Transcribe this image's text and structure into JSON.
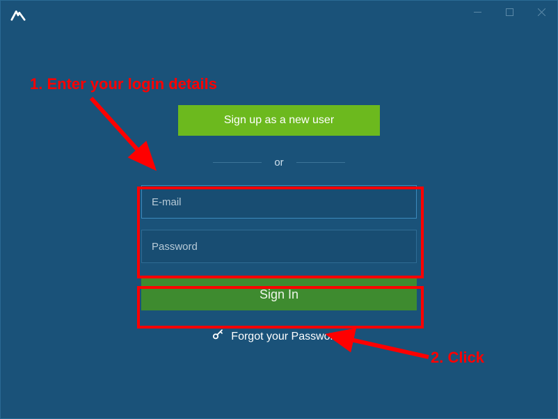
{
  "titlebar": {
    "app_logo": "nord-logo"
  },
  "signup": {
    "label": "Sign up as a new user"
  },
  "divider": {
    "label": "or"
  },
  "email": {
    "placeholder": "E-mail",
    "value": ""
  },
  "password": {
    "placeholder": "Password",
    "value": ""
  },
  "signin": {
    "label": "Sign In"
  },
  "forgot": {
    "label": "Forgot your Password?"
  },
  "annotations": {
    "step1": "1. Enter your login details",
    "step2": "2. Click"
  },
  "colors": {
    "bg": "#1a5279",
    "green_bright": "#6cb91e",
    "green_dark": "#3e8b2f",
    "annotation_red": "#ff0000"
  }
}
